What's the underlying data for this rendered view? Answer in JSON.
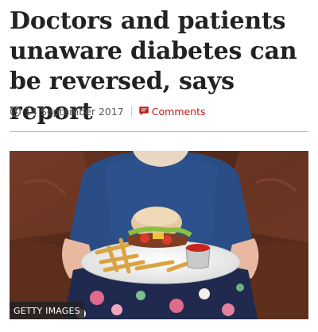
{
  "article": {
    "headline": "Doctors and patients unaware diabetes can be reversed, says report",
    "date": "14 September 2017",
    "comments_label": "Comments",
    "image_credit": "GETTY IMAGES"
  },
  "icons": {
    "date": "clock-icon",
    "comments": "comment-icon"
  },
  "colors": {
    "headline": "#222222",
    "meta_text": "#5a5a5a",
    "comments_accent": "#bb1919",
    "credit_background": "#222222"
  }
}
